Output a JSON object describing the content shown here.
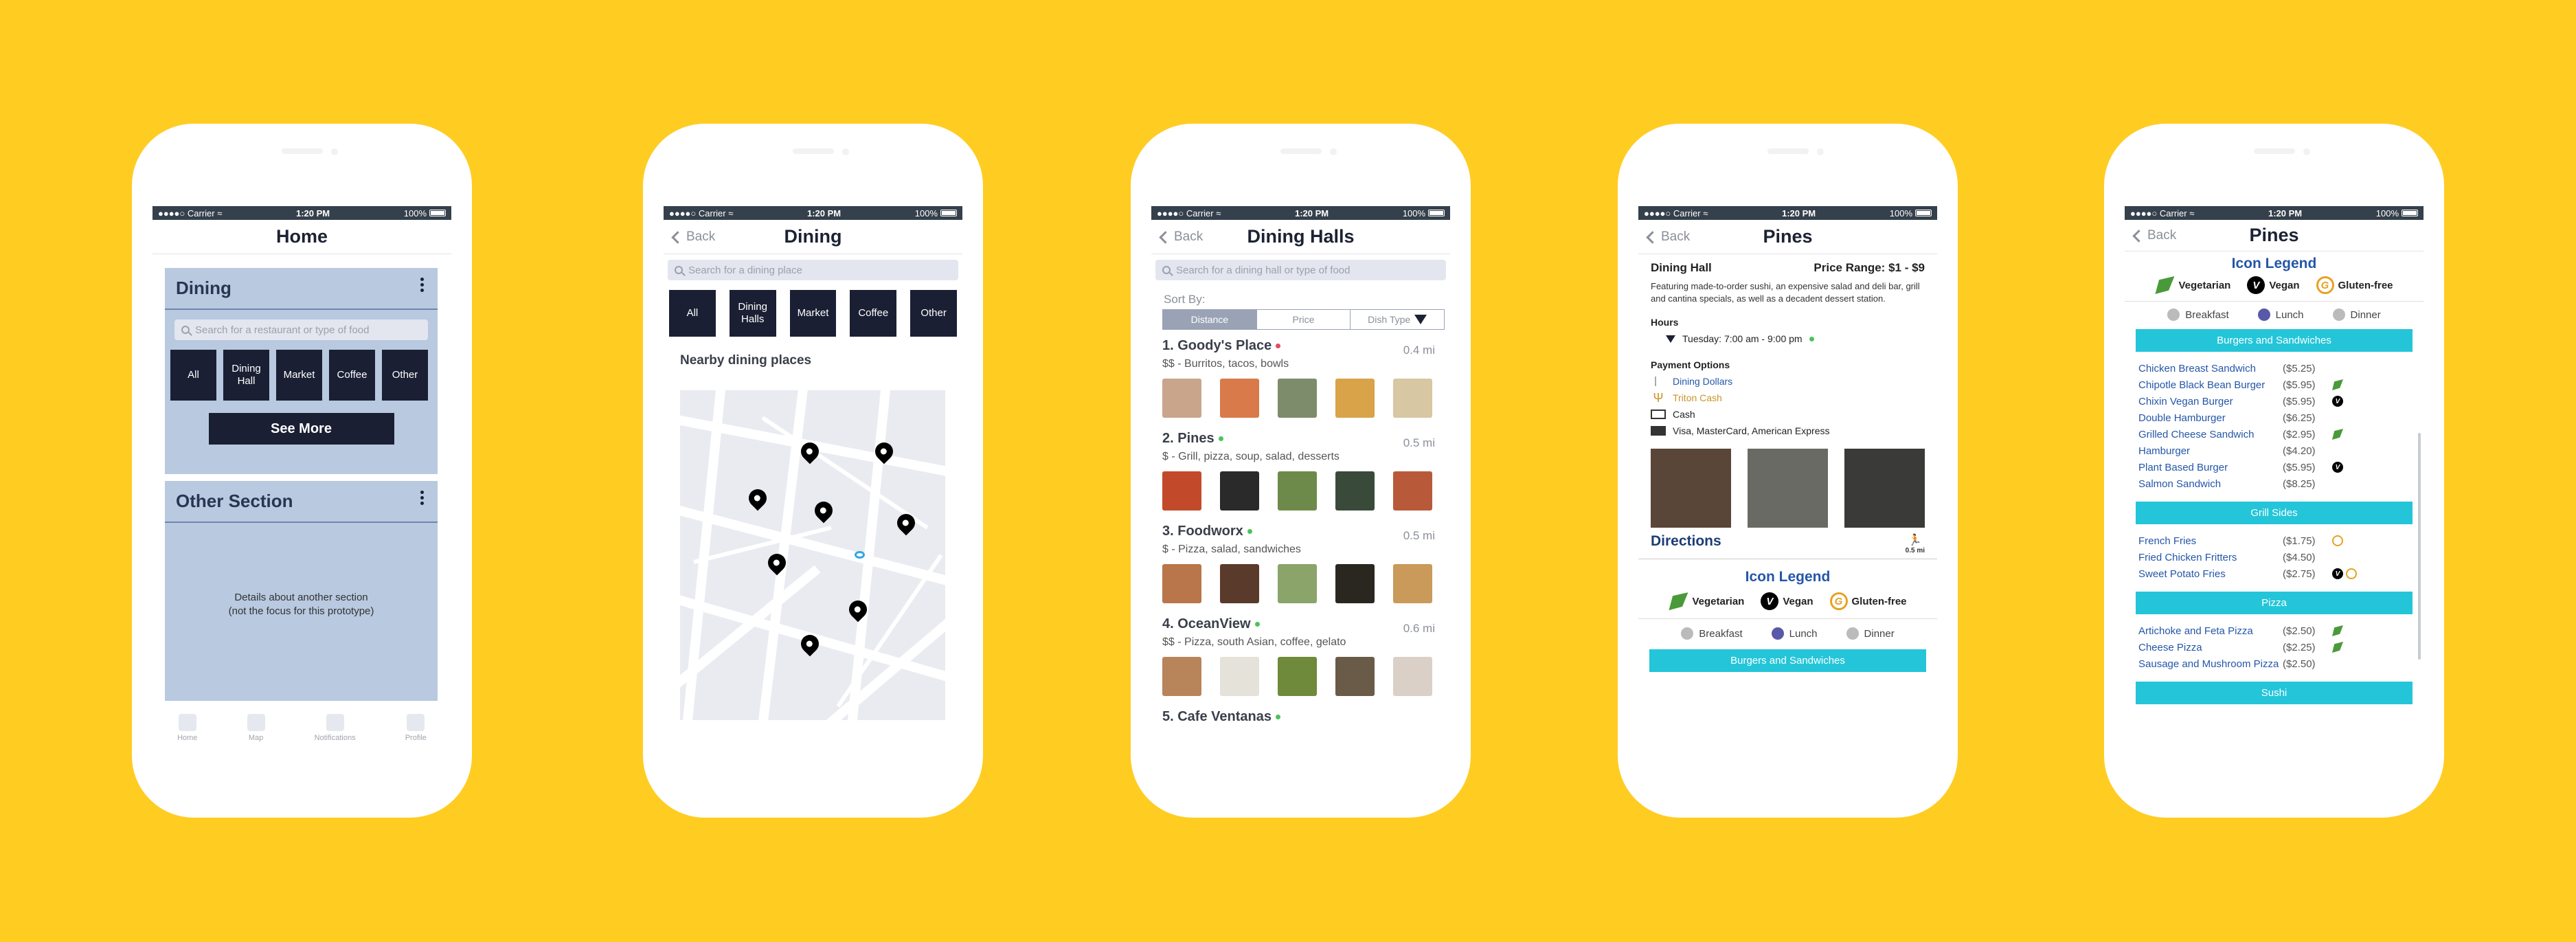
{
  "status": {
    "carrier": "Carrier",
    "time": "1:20 PM",
    "battery": "100%"
  },
  "home": {
    "title": "Home",
    "dining": {
      "title": "Dining",
      "search_placeholder": "Search for a restaurant or type of food",
      "buttons": [
        "All",
        "Dining Hall",
        "Market",
        "Coffee",
        "Other"
      ],
      "see_more": "See More"
    },
    "other": {
      "title": "Other Section",
      "details_line1": "Details about another section",
      "details_line2": "(not the focus for this prototype)"
    },
    "tabs": [
      "Home",
      "Map",
      "Notifications",
      "Profile"
    ]
  },
  "dining": {
    "back": "Back",
    "title": "Dining",
    "search_placeholder": "Search for a dining place",
    "buttons": [
      "All",
      "Dining Halls",
      "Market",
      "Coffee",
      "Other"
    ],
    "nearby": "Nearby dining places"
  },
  "halls": {
    "back": "Back",
    "title": "Dining Halls",
    "search_placeholder": "Search for a dining hall or type of food",
    "sort_by": "Sort By:",
    "sort_options": [
      "Distance",
      "Price",
      "Dish Type"
    ],
    "restaurants": [
      {
        "name": "1. Goody's Place",
        "sub": "$$ - Burritos, tacos, bowls",
        "dist": "0.4 mi",
        "status": "#e84a5f"
      },
      {
        "name": "2. Pines",
        "sub": "$ - Grill, pizza, soup, salad, desserts",
        "dist": "0.5 mi",
        "status": "#4ac45a"
      },
      {
        "name": "3. Foodworx",
        "sub": "$ - Pizza, salad, sandwiches",
        "dist": "0.5 mi",
        "status": "#4ac45a"
      },
      {
        "name": "4. OceanView",
        "sub": "$$ - Pizza, south Asian, coffee, gelato",
        "dist": "0.6 mi",
        "status": "#4ac45a"
      },
      {
        "name": "5. Cafe Ventanas",
        "sub": "",
        "dist": "",
        "status": "#4ac45a"
      }
    ]
  },
  "pines": {
    "back": "Back",
    "title": "Pines",
    "type": "Dining Hall",
    "price_range": "Price Range: $1 - $9",
    "description": "Featuring made-to-order sushi, an expensive salad and deli bar, grill and cantina specials, as well as a decadent dessert station.",
    "hours_label": "Hours",
    "hours": "Tuesday:  7:00 am - 9:00 pm",
    "payment_label": "Payment Options",
    "payments": [
      "Dining Dollars",
      "Triton Cash",
      "Cash",
      "Visa, MasterCard, American Express"
    ],
    "directions": "Directions",
    "distance": "0.5 mi",
    "legend_title": "Icon Legend",
    "legend": [
      "Vegetarian",
      "Vegan",
      "Gluten-free"
    ],
    "meals": [
      "Breakfast",
      "Lunch",
      "Dinner"
    ],
    "category": "Burgers and Sandwiches"
  },
  "menu": {
    "back": "Back",
    "title": "Pines",
    "legend_title": "Icon Legend",
    "legend": [
      "Vegetarian",
      "Vegan",
      "Gluten-free"
    ],
    "meals": [
      "Breakfast",
      "Lunch",
      "Dinner"
    ],
    "sections": [
      {
        "title": "Burgers and Sandwiches",
        "items": [
          {
            "name": "Chicken Breast Sandwich",
            "price": "($5.25)",
            "icons": []
          },
          {
            "name": "Chipotle Black Bean Burger",
            "price": "($5.95)",
            "icons": [
              "veg"
            ]
          },
          {
            "name": "Chixin Vegan Burger",
            "price": "($5.95)",
            "icons": [
              "vegan"
            ]
          },
          {
            "name": "Double Hamburger",
            "price": "($6.25)",
            "icons": []
          },
          {
            "name": "Grilled Cheese Sandwich",
            "price": "($2.95)",
            "icons": [
              "veg"
            ]
          },
          {
            "name": "Hamburger",
            "price": "($4.20)",
            "icons": []
          },
          {
            "name": "Plant Based Burger",
            "price": "($5.95)",
            "icons": [
              "vegan"
            ]
          },
          {
            "name": "Salmon Sandwich",
            "price": "($8.25)",
            "icons": []
          }
        ]
      },
      {
        "title": "Grill Sides",
        "items": [
          {
            "name": "French Fries",
            "price": "($1.75)",
            "icons": [
              "gf"
            ]
          },
          {
            "name": "Fried Chicken Fritters",
            "price": "($4.50)",
            "icons": []
          },
          {
            "name": "Sweet Potato Fries",
            "price": "($2.75)",
            "icons": [
              "vegan",
              "gf"
            ]
          }
        ]
      },
      {
        "title": "Pizza",
        "items": [
          {
            "name": "Artichoke and Feta Pizza",
            "price": "($2.50)",
            "icons": [
              "veg"
            ]
          },
          {
            "name": "Cheese Pizza",
            "price": "($2.25)",
            "icons": [
              "veg"
            ]
          },
          {
            "name": "Sausage and Mushroom Pizza",
            "price": "($2.50)",
            "icons": []
          }
        ]
      },
      {
        "title": "Sushi",
        "items": []
      }
    ]
  },
  "colors": {
    "background": "#FFCC22",
    "navy": "#1a1f33",
    "panel": "#b8c9e0",
    "accent": "#24c5d9",
    "link": "#2456a8"
  }
}
